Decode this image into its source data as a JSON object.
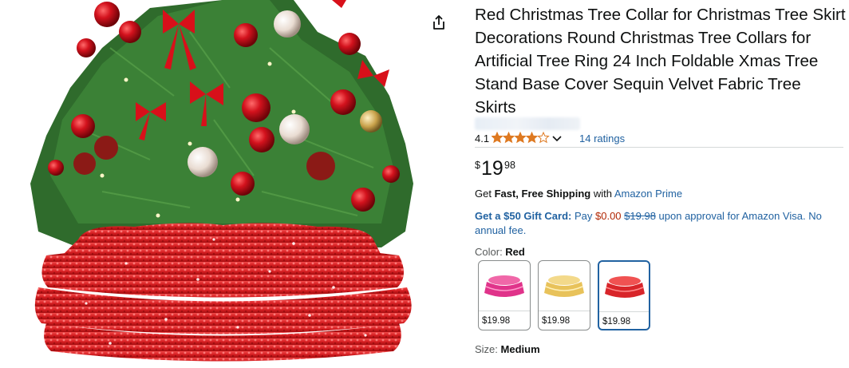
{
  "product": {
    "title": "Red Christmas Tree Collar for Christmas Tree Skirt Decorations Round Christmas Tree Collars for Artificial Tree Ring 24 Inch Foldable Xmas Tree Stand Base Cover Sequin Velvet Fabric Tree Skirts",
    "rating_value": "4.1",
    "rating": 4.1,
    "ratings_count": "14 ratings",
    "price": {
      "symbol": "$",
      "whole": "19",
      "fraction": "98"
    },
    "shipping": {
      "prefix": "Get ",
      "fast": "Fast, Free Shipping",
      "mid": " with ",
      "prime": "Amazon Prime"
    },
    "gift": {
      "label": "Get a $50 Gift Card:",
      "pay": " Pay ",
      "pay_price": "$0.00",
      "old_price": "$19.98",
      "rest": " upon approval for Amazon Visa. No annual fee."
    },
    "color": {
      "label": "Color: ",
      "selected": "Red"
    },
    "swatches": [
      {
        "name": "Pink",
        "price": "$19.98",
        "color": "#e0338a",
        "selected": false
      },
      {
        "name": "Gold",
        "price": "$19.98",
        "color": "#e8c25a",
        "selected": false
      },
      {
        "name": "Red",
        "price": "$19.98",
        "color": "#d8252a",
        "selected": true
      }
    ],
    "size": {
      "label": "Size: ",
      "selected": "Medium"
    }
  },
  "colors": {
    "link": "#2162a1",
    "price_red": "#b12704",
    "star": "#de7921",
    "selected_border": "#2162a1"
  },
  "icons": {
    "share": "share-icon",
    "chevron": "chevron-down-icon",
    "star": "star-icon"
  }
}
